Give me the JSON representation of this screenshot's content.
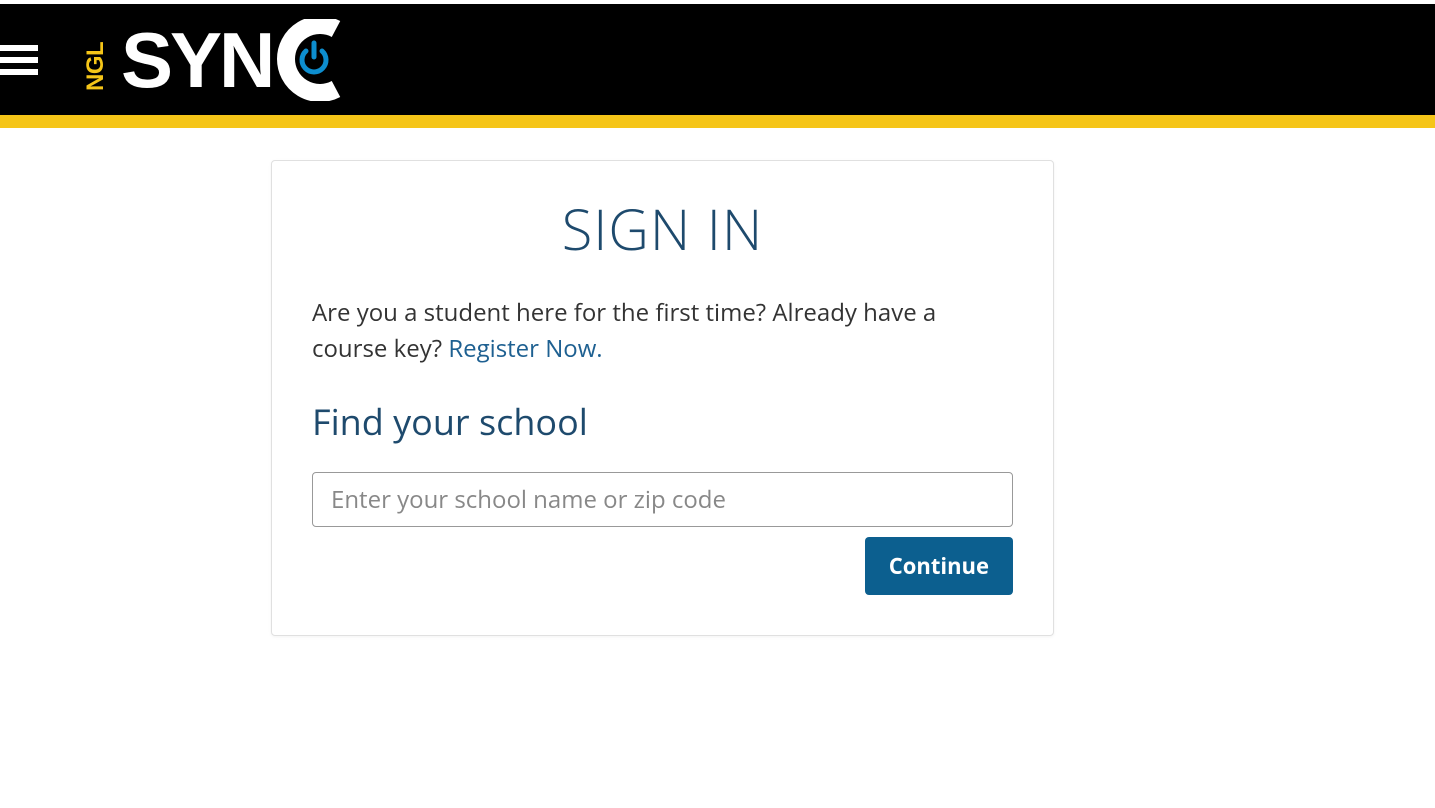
{
  "header": {
    "logo_ngl": "NGL",
    "logo_sync_s": "S",
    "logo_sync_y": "Y",
    "logo_sync_n": "N",
    "logo_sync_c": "C"
  },
  "card": {
    "title": "SIGN IN",
    "intro_text": "Are you a student here for the first time? Already have a course key? ",
    "register_link": "Register Now.",
    "section_title": "Find your school",
    "search_placeholder": "Enter your school name or zip code",
    "continue_label": "Continue"
  },
  "colors": {
    "accent_yellow": "#f5c518",
    "brand_blue": "#1e4a6d",
    "button_blue": "#0c5f8f",
    "power_blue": "#0d8ecf"
  }
}
